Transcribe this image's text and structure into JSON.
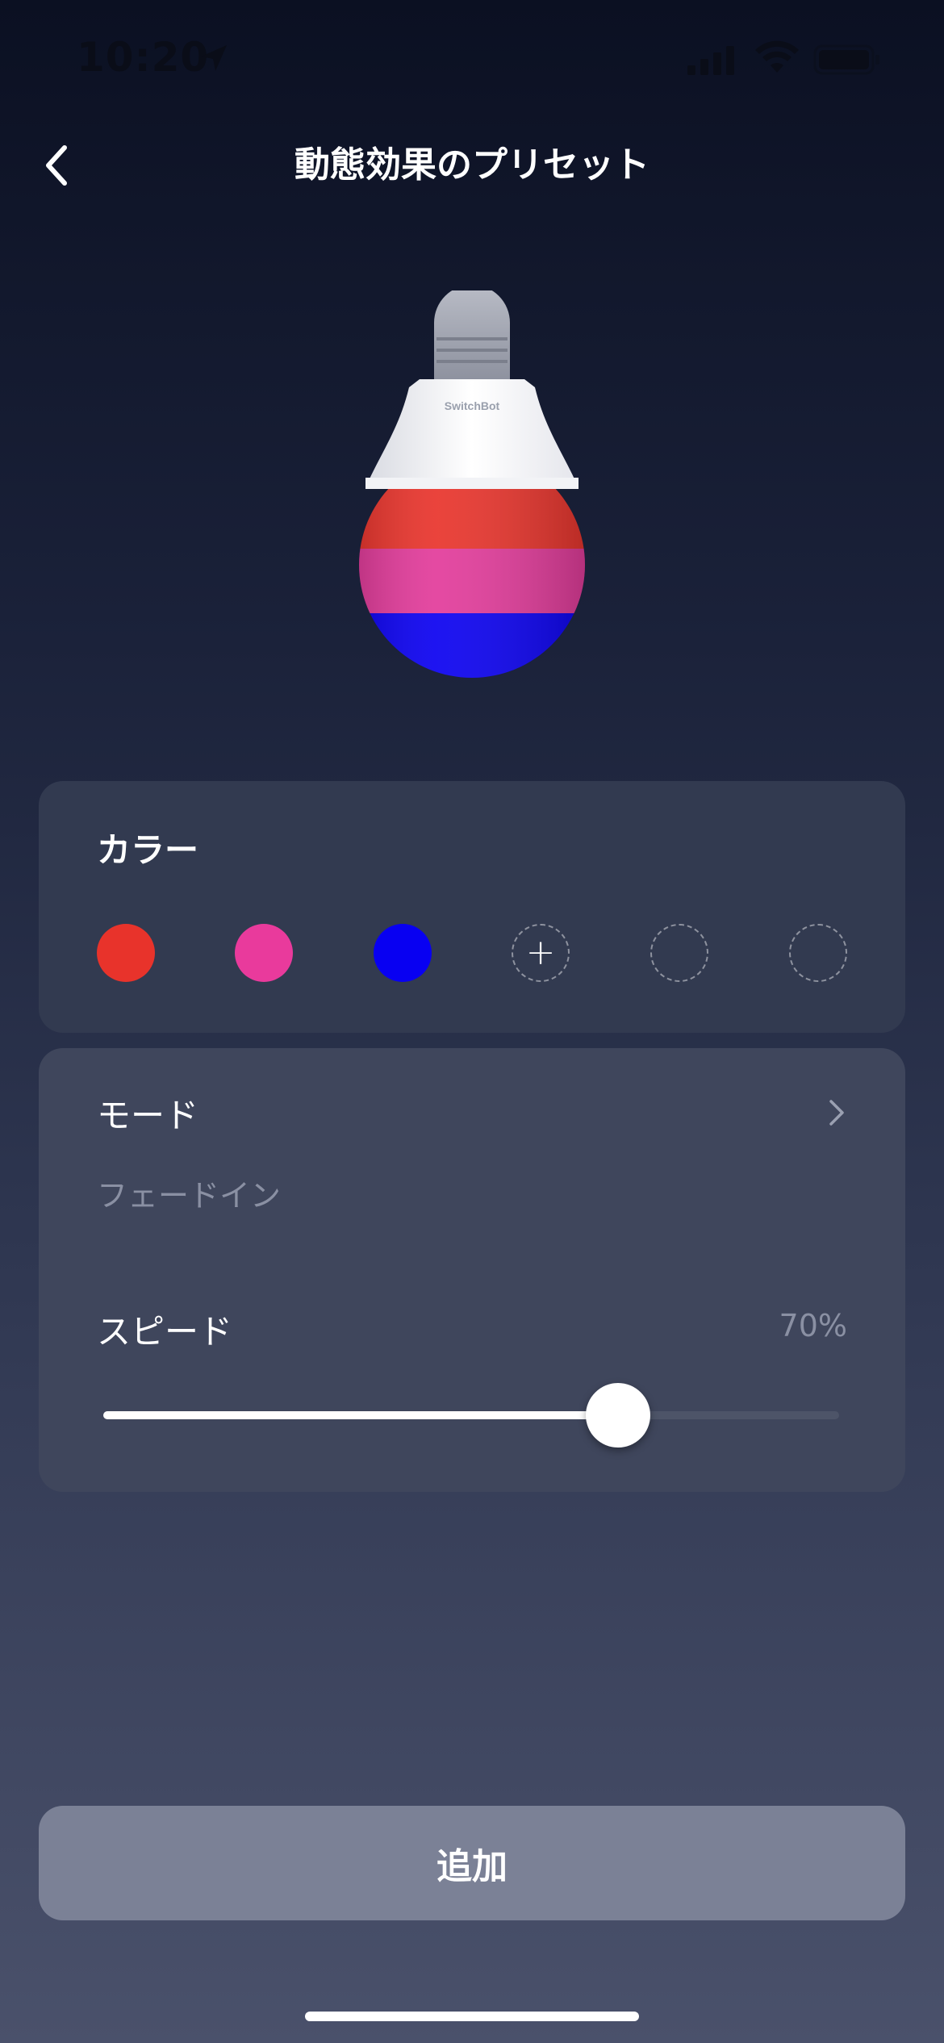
{
  "status_bar": {
    "time": "10:20",
    "icons": [
      "location-arrow-icon",
      "cellular-signal-icon",
      "wifi-icon",
      "battery-icon"
    ]
  },
  "header": {
    "title": "動態効果のプリセット",
    "back_icon": "chevron-left-icon"
  },
  "bulb": {
    "brand": "SwitchBot",
    "stripe_colors": [
      "#e8332b",
      "#e23a9a",
      "#0a00f0"
    ]
  },
  "colors_section": {
    "title": "カラー",
    "swatches": [
      {
        "color": "#e8332b",
        "state": "filled"
      },
      {
        "color": "#e93a9c",
        "state": "filled"
      },
      {
        "color": "#0800f2",
        "state": "filled"
      },
      {
        "state": "add",
        "icon": "plus-icon",
        "glyph": "+"
      },
      {
        "state": "empty"
      },
      {
        "state": "empty"
      }
    ]
  },
  "mode_section": {
    "title": "モード",
    "value": "フェードイン",
    "chevron_icon": "chevron-right-icon"
  },
  "speed_section": {
    "title": "スピード",
    "value_text": "70%",
    "value_fraction": 0.7
  },
  "add_button": {
    "label": "追加"
  }
}
